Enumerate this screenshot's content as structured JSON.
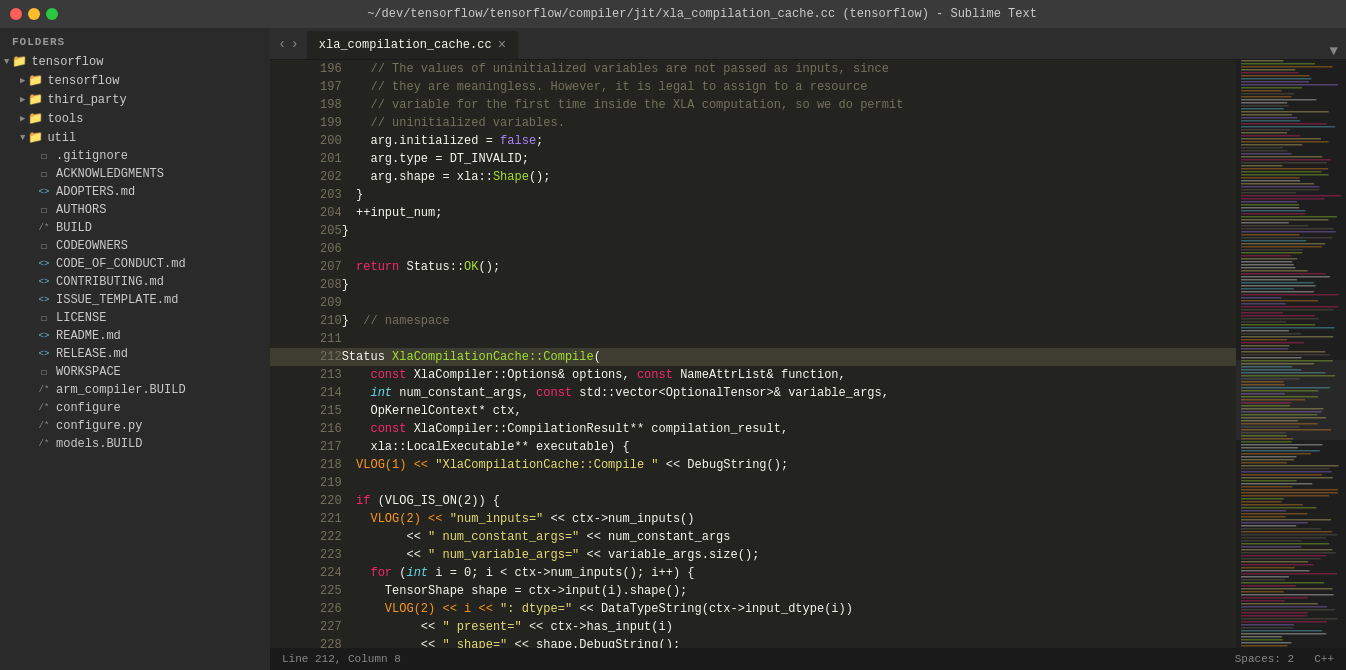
{
  "titlebar": {
    "title": "~/dev/tensorflow/tensorflow/compiler/jit/xla_compilation_cache.cc (tensorflow) - Sublime Text"
  },
  "sidebar": {
    "header": "FOLDERS",
    "items": [
      {
        "id": "tensorflow-root",
        "label": "tensorflow",
        "type": "folder-open",
        "indent": 0
      },
      {
        "id": "tensorflow-sub",
        "label": "tensorflow",
        "type": "folder-closed",
        "indent": 1
      },
      {
        "id": "third-party",
        "label": "third_party",
        "type": "folder-closed",
        "indent": 1
      },
      {
        "id": "tools",
        "label": "tools",
        "type": "folder-closed",
        "indent": 1
      },
      {
        "id": "util",
        "label": "util",
        "type": "folder-open",
        "indent": 1
      },
      {
        "id": "gitignore",
        "label": ".gitignore",
        "type": "file",
        "indent": 2
      },
      {
        "id": "acknowledgments",
        "label": "ACKNOWLEDGMENTS",
        "type": "file",
        "indent": 2
      },
      {
        "id": "adopters",
        "label": "ADOPTERS.md",
        "type": "file-cpp",
        "indent": 2
      },
      {
        "id": "authors",
        "label": "AUTHORS",
        "type": "file",
        "indent": 2
      },
      {
        "id": "build",
        "label": "BUILD",
        "type": "file-star",
        "indent": 2
      },
      {
        "id": "codeowners",
        "label": "CODEOWNERS",
        "type": "file",
        "indent": 2
      },
      {
        "id": "code-of-conduct",
        "label": "CODE_OF_CONDUCT.md",
        "type": "file-cpp",
        "indent": 2
      },
      {
        "id": "contributing",
        "label": "CONTRIBUTING.md",
        "type": "file-cpp",
        "indent": 2
      },
      {
        "id": "issue-template",
        "label": "ISSUE_TEMPLATE.md",
        "type": "file-cpp",
        "indent": 2
      },
      {
        "id": "license",
        "label": "LICENSE",
        "type": "file",
        "indent": 2
      },
      {
        "id": "readme",
        "label": "README.md",
        "type": "file-cpp",
        "indent": 2
      },
      {
        "id": "release",
        "label": "RELEASE.md",
        "type": "file-cpp",
        "indent": 2
      },
      {
        "id": "workspace",
        "label": "WORKSPACE",
        "type": "file",
        "indent": 2
      },
      {
        "id": "arm-compiler-build",
        "label": "arm_compiler.BUILD",
        "type": "file-star",
        "indent": 2
      },
      {
        "id": "configure",
        "label": "configure",
        "type": "file-star",
        "indent": 2
      },
      {
        "id": "configure-py",
        "label": "configure.py",
        "type": "file-star",
        "indent": 2
      },
      {
        "id": "models-build",
        "label": "models.BUILD",
        "type": "file-star",
        "indent": 2
      }
    ]
  },
  "tabs": [
    {
      "id": "xla-tab",
      "label": "xla_compilation_cache.cc",
      "active": true
    }
  ],
  "statusbar": {
    "left": "Line 212, Column 8",
    "right_spaces": "Spaces: 2",
    "right_lang": "C++"
  },
  "code": {
    "lines": [
      {
        "num": 196,
        "tokens": [
          {
            "t": "    // The values of uninitialized variables are not passed as inputs, since",
            "c": "c-comment"
          }
        ]
      },
      {
        "num": 197,
        "tokens": [
          {
            "t": "    // they are meaningless. However, it is legal to assign to a resource",
            "c": "c-comment"
          }
        ]
      },
      {
        "num": 198,
        "tokens": [
          {
            "t": "    // variable for the first time inside the XLA computation, so we do permit",
            "c": "c-comment"
          }
        ]
      },
      {
        "num": 199,
        "tokens": [
          {
            "t": "    // uninitialized variables.",
            "c": "c-comment"
          }
        ]
      },
      {
        "num": 200,
        "tokens": [
          {
            "t": "    arg.initialized = ",
            "c": "c-plain"
          },
          {
            "t": "false",
            "c": "c-bool"
          },
          {
            "t": ";",
            "c": "c-plain"
          }
        ]
      },
      {
        "num": 201,
        "tokens": [
          {
            "t": "    arg.type = DT_INVALID;",
            "c": "c-plain"
          }
        ]
      },
      {
        "num": 202,
        "tokens": [
          {
            "t": "    arg.shape = xla::",
            "c": "c-plain"
          },
          {
            "t": "Shape",
            "c": "c-function"
          },
          {
            "t": "();",
            "c": "c-plain"
          }
        ]
      },
      {
        "num": 203,
        "tokens": [
          {
            "t": "  }",
            "c": "c-plain"
          }
        ]
      },
      {
        "num": 204,
        "tokens": [
          {
            "t": "  ++input_num;",
            "c": "c-plain"
          }
        ]
      },
      {
        "num": 205,
        "tokens": [
          {
            "t": "}",
            "c": "c-plain"
          }
        ]
      },
      {
        "num": 206,
        "tokens": [
          {
            "t": "",
            "c": "c-plain"
          }
        ]
      },
      {
        "num": 207,
        "tokens": [
          {
            "t": "  ",
            "c": "c-plain"
          },
          {
            "t": "return",
            "c": "c-keyword"
          },
          {
            "t": " Status::",
            "c": "c-plain"
          },
          {
            "t": "OK",
            "c": "c-function"
          },
          {
            "t": "();",
            "c": "c-plain"
          }
        ]
      },
      {
        "num": 208,
        "tokens": [
          {
            "t": "}",
            "c": "c-plain"
          }
        ]
      },
      {
        "num": 209,
        "tokens": [
          {
            "t": "",
            "c": "c-plain"
          }
        ]
      },
      {
        "num": 210,
        "tokens": [
          {
            "t": "}  ",
            "c": "c-plain"
          },
          {
            "t": "// namespace",
            "c": "c-comment"
          }
        ]
      },
      {
        "num": 211,
        "tokens": [
          {
            "t": "",
            "c": "c-plain"
          }
        ]
      },
      {
        "num": 212,
        "tokens": [
          {
            "t": "Status ",
            "c": "c-plain"
          },
          {
            "t": "XlaCompilationCache::Compile",
            "c": "c-function"
          },
          {
            "t": "(",
            "c": "c-plain"
          }
        ],
        "selected": true
      },
      {
        "num": 213,
        "tokens": [
          {
            "t": "    ",
            "c": "c-plain"
          },
          {
            "t": "const",
            "c": "c-keyword"
          },
          {
            "t": " XlaCompiler::Options",
            "c": "c-plain"
          },
          {
            "t": "& options, ",
            "c": "c-plain"
          },
          {
            "t": "const",
            "c": "c-keyword"
          },
          {
            "t": " NameAttrList",
            "c": "c-plain"
          },
          {
            "t": "& function,",
            "c": "c-plain"
          }
        ]
      },
      {
        "num": 214,
        "tokens": [
          {
            "t": "    ",
            "c": "c-plain"
          },
          {
            "t": "int",
            "c": "c-type"
          },
          {
            "t": " num_constant_args, ",
            "c": "c-plain"
          },
          {
            "t": "const",
            "c": "c-keyword"
          },
          {
            "t": " std::vector<OptionalTensor>",
            "c": "c-plain"
          },
          {
            "t": "& variable_args,",
            "c": "c-plain"
          }
        ]
      },
      {
        "num": 215,
        "tokens": [
          {
            "t": "    OpKernelContext* ctx,",
            "c": "c-plain"
          }
        ]
      },
      {
        "num": 216,
        "tokens": [
          {
            "t": "    ",
            "c": "c-plain"
          },
          {
            "t": "const",
            "c": "c-keyword"
          },
          {
            "t": " XlaCompiler::CompilationResult** compilation_result,",
            "c": "c-plain"
          }
        ]
      },
      {
        "num": 217,
        "tokens": [
          {
            "t": "    xla::LocalExecutable** executable) {",
            "c": "c-plain"
          }
        ]
      },
      {
        "num": 218,
        "tokens": [
          {
            "t": "  VLOG(1) << ",
            "c": "c-var"
          },
          {
            "t": "\"XlaCompilationCache::Compile \"",
            "c": "c-string"
          },
          {
            "t": " << DebugString();",
            "c": "c-plain"
          }
        ]
      },
      {
        "num": 219,
        "tokens": [
          {
            "t": "",
            "c": "c-plain"
          }
        ]
      },
      {
        "num": 220,
        "tokens": [
          {
            "t": "  ",
            "c": "c-plain"
          },
          {
            "t": "if",
            "c": "c-keyword"
          },
          {
            "t": " (VLOG_IS_ON(2)) {",
            "c": "c-plain"
          }
        ]
      },
      {
        "num": 221,
        "tokens": [
          {
            "t": "    VLOG(2) << ",
            "c": "c-var"
          },
          {
            "t": "\"num_inputs=\"",
            "c": "c-string"
          },
          {
            "t": " << ctx->num_inputs()",
            "c": "c-plain"
          }
        ]
      },
      {
        "num": 222,
        "tokens": [
          {
            "t": "         << ",
            "c": "c-plain"
          },
          {
            "t": "\" num_constant_args=\"",
            "c": "c-string"
          },
          {
            "t": " << num_constant_args",
            "c": "c-plain"
          }
        ]
      },
      {
        "num": 223,
        "tokens": [
          {
            "t": "         << ",
            "c": "c-plain"
          },
          {
            "t": "\" num_variable_args=\"",
            "c": "c-string"
          },
          {
            "t": " << variable_args.size();",
            "c": "c-plain"
          }
        ]
      },
      {
        "num": 224,
        "tokens": [
          {
            "t": "    ",
            "c": "c-plain"
          },
          {
            "t": "for",
            "c": "c-keyword"
          },
          {
            "t": " (",
            "c": "c-plain"
          },
          {
            "t": "int",
            "c": "c-type"
          },
          {
            "t": " i = 0; i < ctx->num_inputs(); i++) {",
            "c": "c-plain"
          }
        ]
      },
      {
        "num": 225,
        "tokens": [
          {
            "t": "      TensorShape shape = ctx->input(i).shape();",
            "c": "c-plain"
          }
        ]
      },
      {
        "num": 226,
        "tokens": [
          {
            "t": "      VLOG(2) << i << ",
            "c": "c-var"
          },
          {
            "t": "\": dtype=\"",
            "c": "c-string"
          },
          {
            "t": " << DataTypeString(ctx->input_dtype(i))",
            "c": "c-plain"
          }
        ]
      },
      {
        "num": 227,
        "tokens": [
          {
            "t": "           << ",
            "c": "c-plain"
          },
          {
            "t": "\" present=\"",
            "c": "c-string"
          },
          {
            "t": " << ctx->has_input(i)",
            "c": "c-plain"
          }
        ]
      },
      {
        "num": 228,
        "tokens": [
          {
            "t": "           << ",
            "c": "c-plain"
          },
          {
            "t": "\" shape=\"",
            "c": "c-string"
          },
          {
            "t": " << shape.DebugString();",
            "c": "c-plain"
          }
        ]
      }
    ]
  }
}
